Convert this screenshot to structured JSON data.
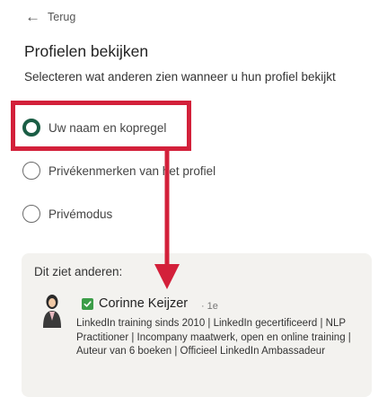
{
  "back": {
    "label": "Terug",
    "icon": "arrow-left-icon"
  },
  "title": "Profielen bekijken",
  "subtitle": "Selecteren wat anderen zien wanneer u hun profiel bekijkt",
  "options": [
    {
      "label": "Uw naam en kopregel",
      "selected": true
    },
    {
      "label": "Privékenmerken van het profiel",
      "selected": false
    },
    {
      "label": "Privémodus",
      "selected": false
    }
  ],
  "preview": {
    "heading": "Dit ziet anderen:",
    "name": "Corinne Keijzer",
    "degree": "1e",
    "headline": "LinkedIn training sinds 2010 | LinkedIn gecertificeerd | NLP Practitioner | Incompany maatwerk, open en online training | Auteur van 6 boeken | Officieel LinkedIn Ambassadeur"
  },
  "colors": {
    "selected_radio": "#1b5e45",
    "annotation_red": "#d3203a",
    "check_green": "#3c9d48",
    "preview_bg": "#f3f2ef"
  }
}
